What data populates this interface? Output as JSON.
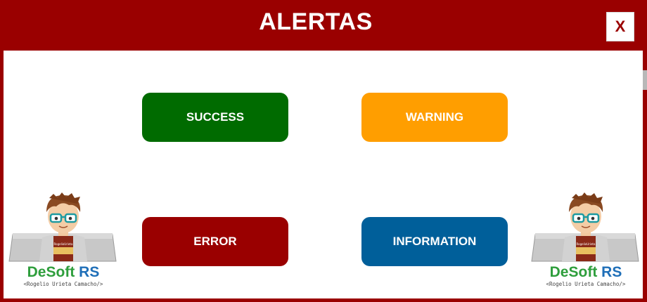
{
  "window": {
    "title": "ALERTAS",
    "close_label": "X"
  },
  "buttons": {
    "success": "SUCCESS",
    "warning": "WARNING",
    "error": "ERROR",
    "information": "INFORMATION"
  },
  "logo": {
    "brand_part1": "DeSoft",
    "brand_part2": "RS",
    "author": "<Rogelio Urieta Camacho/>",
    "shirt_text": "RogelioUrieta"
  },
  "colors": {
    "title_bar": "#9a0000",
    "success": "#006b00",
    "warning": "#ff9e00",
    "error": "#9a0000",
    "information": "#005f9a",
    "brand_green": "#2e9e3c",
    "brand_blue": "#1f6fb8"
  }
}
